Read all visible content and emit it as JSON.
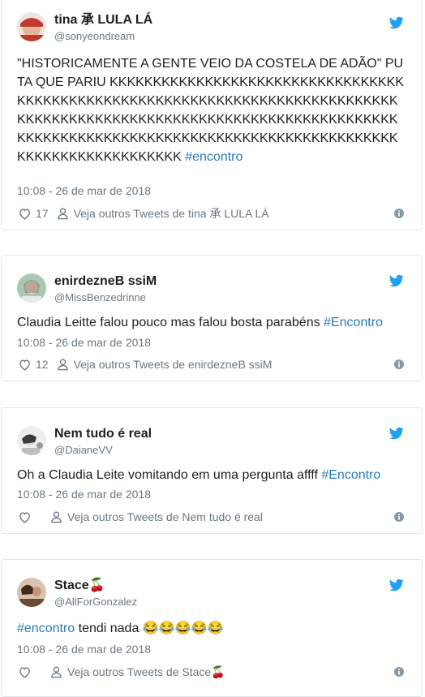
{
  "tweets": [
    {
      "name": "tina 承 LULA LÁ",
      "handle": "@sonyeondream",
      "text": "\"HISTORICAMENTE A GENTE VEIO DA COSTELA DE ADÃO\" PUTA QUE PARIU KKKKKKKKKKKKKKKKKKKKKKKKKKKKKKKKKKKKKKKKKKKKKKKKKKKKKKKKKKKKKKKKKKKKKKKKKKKKKKKKKKKKKKKKKKKKKKKKKKKKKKKKKKKKKKKKKKKKKKKKKKKKKKKKKKKKKKKKKKKKKKKKKKKKKKKKKKKKKKKKKKKKKKKKKKKKKKKKKKKKKKKKK ",
      "hashtag": "#encontro",
      "timestamp": "10:08 - 26 de mar de 2018",
      "likes": "17",
      "more_tweets": "Veja outros Tweets de tina 承 LULA LÁ",
      "avatar_color": "#c0392b"
    },
    {
      "name": "enirdezneB ssiM",
      "handle": "@MissBenzedrinne",
      "text": "Claudia Leitte falou pouco mas falou bosta parabéns ",
      "hashtag": "#Encontro",
      "timestamp": "10:08 - 26 de mar de 2018",
      "likes": "12",
      "more_tweets": "Veja outros Tweets de enirdezneB ssiM",
      "avatar_color": "#7ba987"
    },
    {
      "name": "Nem tudo é real",
      "handle": "@DaianeVV",
      "text": "Oh a Claudia Leite vomitando em uma pergunta affff ",
      "hashtag": "#Encontro",
      "timestamp": "10:08 - 26 de mar de 2018",
      "likes": "",
      "more_tweets": "Veja outros Tweets de Nem tudo é real",
      "avatar_color": "#d8d8d8"
    },
    {
      "name": "Stace🍒",
      "handle": "@AllForGonzalez",
      "hashtag": "#encontro",
      "text": " tendi nada 😂😂😂😂😂",
      "timestamp": "10:08 - 26 de mar de 2018",
      "likes": "",
      "more_tweets": "Veja outros Tweets de Stace🍒",
      "avatar_color": "#8a6a55"
    }
  ],
  "colors": {
    "link": "#2b7bb9",
    "muted": "#697882",
    "bird": "#1da1f2",
    "border": "#e1e8ed"
  },
  "icons": [
    "twitter-bird-icon",
    "heart-icon",
    "person-icon",
    "info-icon"
  ]
}
